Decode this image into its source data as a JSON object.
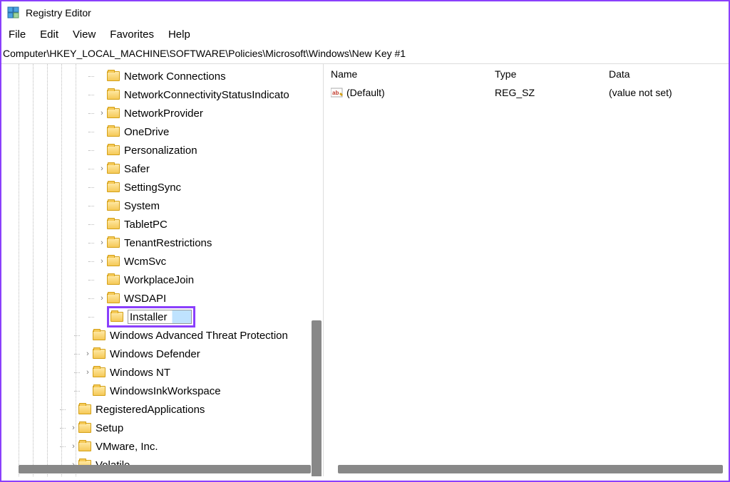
{
  "app": {
    "title": "Registry Editor"
  },
  "menu": {
    "file": "File",
    "edit": "Edit",
    "view": "View",
    "favorites": "Favorites",
    "help": "Help"
  },
  "address": "Computer\\HKEY_LOCAL_MACHINE\\SOFTWARE\\Policies\\Microsoft\\Windows\\New Key #1",
  "tree": {
    "items": [
      {
        "label": "Network Connections",
        "indent": 140,
        "chevron": ""
      },
      {
        "label": "NetworkConnectivityStatusIndicato",
        "indent": 140,
        "chevron": ""
      },
      {
        "label": "NetworkProvider",
        "indent": 140,
        "chevron": ">"
      },
      {
        "label": "OneDrive",
        "indent": 140,
        "chevron": ""
      },
      {
        "label": "Personalization",
        "indent": 140,
        "chevron": ""
      },
      {
        "label": "Safer",
        "indent": 140,
        "chevron": ">"
      },
      {
        "label": "SettingSync",
        "indent": 140,
        "chevron": ""
      },
      {
        "label": "System",
        "indent": 140,
        "chevron": ""
      },
      {
        "label": "TabletPC",
        "indent": 140,
        "chevron": ""
      },
      {
        "label": "TenantRestrictions",
        "indent": 140,
        "chevron": ">"
      },
      {
        "label": "WcmSvc",
        "indent": 140,
        "chevron": ">"
      },
      {
        "label": "WorkplaceJoin",
        "indent": 140,
        "chevron": ""
      },
      {
        "label": "WSDAPI",
        "indent": 140,
        "chevron": ">"
      }
    ],
    "editing": {
      "value": "Installer",
      "indent": 140
    },
    "after": [
      {
        "label": "Windows Advanced Threat Protection",
        "indent": 120,
        "chevron": ""
      },
      {
        "label": "Windows Defender",
        "indent": 120,
        "chevron": ">"
      },
      {
        "label": "Windows NT",
        "indent": 120,
        "chevron": ">"
      },
      {
        "label": "WindowsInkWorkspace",
        "indent": 120,
        "chevron": ""
      },
      {
        "label": "RegisteredApplications",
        "indent": 100,
        "chevron": ""
      },
      {
        "label": "Setup",
        "indent": 100,
        "chevron": ">"
      },
      {
        "label": "VMware, Inc.",
        "indent": 100,
        "chevron": ">"
      },
      {
        "label": "Volatile",
        "indent": 100,
        "chevron": ">"
      }
    ]
  },
  "list": {
    "headers": {
      "name": "Name",
      "type": "Type",
      "data": "Data"
    },
    "rows": [
      {
        "name": "(Default)",
        "type": "REG_SZ",
        "data": "(value not set)"
      }
    ]
  }
}
